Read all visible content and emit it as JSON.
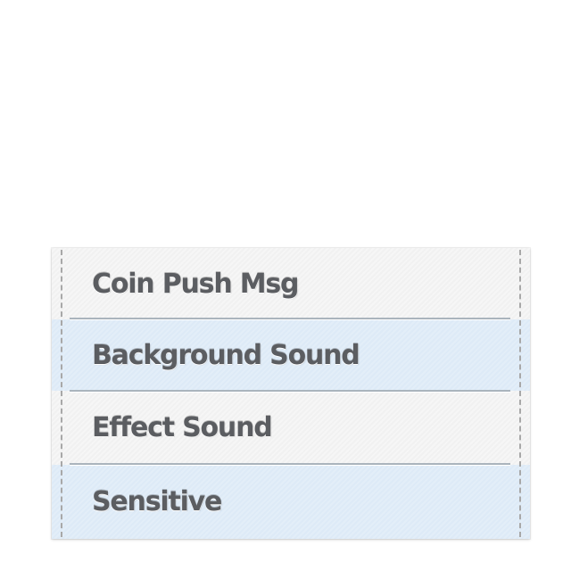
{
  "settings": {
    "items": [
      {
        "label": "Coin Push Msg",
        "highlighted": false
      },
      {
        "label": "Background Sound",
        "highlighted": true
      },
      {
        "label": "Effect Sound",
        "highlighted": false
      },
      {
        "label": "Sensitive",
        "highlighted": true
      }
    ]
  },
  "colors": {
    "panel_background": "#f6f6f6",
    "highlight_row": "#ddeaf7",
    "label_text": "#5b5d61",
    "stitching": "#a8a8a8",
    "divider": "#aab4bd"
  }
}
